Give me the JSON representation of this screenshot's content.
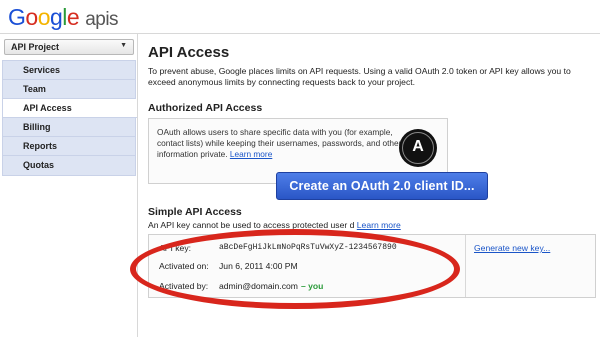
{
  "header": {
    "logo_letters": [
      "G",
      "o",
      "o",
      "g",
      "l",
      "e"
    ],
    "logo_suffix": "apis"
  },
  "sidebar": {
    "project_select": "API Project",
    "items": [
      {
        "label": "Services",
        "active": false
      },
      {
        "label": "Team",
        "active": false
      },
      {
        "label": "API Access",
        "active": true
      },
      {
        "label": "Billing",
        "active": false
      },
      {
        "label": "Reports",
        "active": false
      },
      {
        "label": "Quotas",
        "active": false
      }
    ]
  },
  "main": {
    "title": "API Access",
    "intro": "To prevent abuse, Google places limits on API requests. Using a valid OAuth 2.0 token or API key allows you to exceed anonymous limits by connecting requests back to your project.",
    "authorized": {
      "title": "Authorized API Access",
      "text": "OAuth allows users to share specific data with you (for example, contact lists) while keeping their usernames, passwords, and other information private.",
      "learn_more": "Learn more",
      "logo_letter": "A",
      "create_button": "Create an OAuth 2.0 client ID..."
    },
    "simple": {
      "title": "Simple API Access",
      "desc_visible_start": "An API key",
      "desc_visible_mid": "cannot be used to access protected user d",
      "learn_more": "Learn more",
      "api_key_label": "API key:",
      "api_key_value": "aBcDeFgHiJkLmNoPqRsTuVwXyZ-1234567890",
      "activated_on_label": "Activated on:",
      "activated_on_value": "Jun 6, 2011 4:00 PM",
      "activated_by_label": "Activated by:",
      "activated_by_value": "admin@domain.com",
      "activated_by_you": "– you",
      "generate_link": "Generate new key..."
    }
  },
  "colors": {
    "accent_blue": "#2a56c6",
    "annotation_red": "#d8261c",
    "nav_bg": "#dde4f3"
  }
}
